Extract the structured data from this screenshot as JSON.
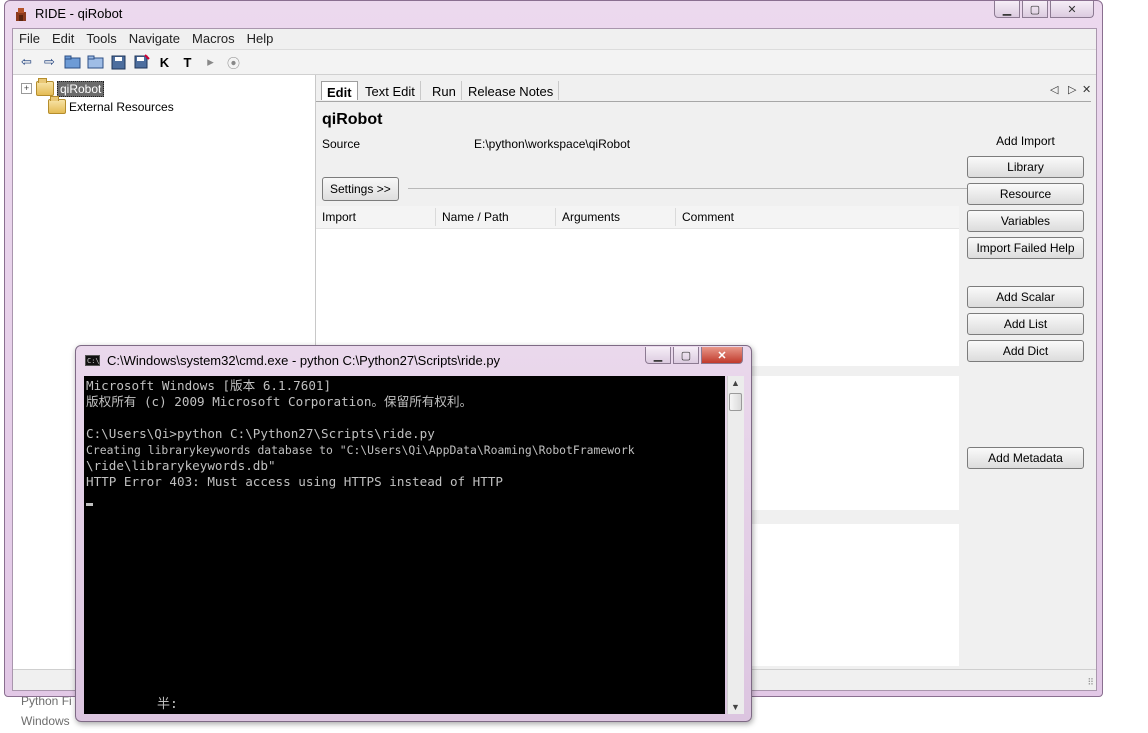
{
  "ride": {
    "title": "RIDE - qiRobot",
    "menu": [
      "File",
      "Edit",
      "Tools",
      "Navigate",
      "Macros",
      "Help"
    ],
    "toolbar_icons": [
      "back-icon",
      "forward-icon",
      "open-suite-icon",
      "open-directory-icon",
      "save-icon",
      "save-all-icon",
      "keyword-search-icon",
      "test-search-icon",
      "run-icon",
      "stop-icon"
    ],
    "toolbar_glyphs": {
      "keyword": "K",
      "test": "T"
    },
    "tree": {
      "root": "qiRobot",
      "external": "External Resources"
    },
    "tabs": [
      "Edit",
      "Text Edit",
      "Run",
      "Release Notes"
    ],
    "editor": {
      "suite_name": "qiRobot",
      "source_label": "Source",
      "source_value": "E:\\python\\workspace\\qiRobot",
      "settings_button": "Settings >>",
      "import_columns": [
        "Import",
        "Name / Path",
        "Arguments",
        "Comment"
      ],
      "add_import_label": "Add Import",
      "import_buttons": [
        "Library",
        "Resource",
        "Variables",
        "Import Failed Help"
      ],
      "variable_buttons": [
        "Add Scalar",
        "Add List",
        "Add Dict"
      ],
      "metadata_button": "Add Metadata"
    }
  },
  "cmd": {
    "title": "C:\\Windows\\system32\\cmd.exe - python  C:\\Python27\\Scripts\\ride.py",
    "lines": [
      "Microsoft Windows [版本 6.1.7601]",
      "版权所有 (c) 2009 Microsoft Corporation。保留所有权利。",
      "",
      "C:\\Users\\Qi>python C:\\Python27\\Scripts\\ride.py",
      "Creating librarykeywords database to \"C:\\Users\\Qi\\AppData\\Roaming\\RobotFramework",
      "\\ride\\librarykeywords.db\"",
      "HTTP Error 403: Must access using HTTPS instead of HTTP"
    ],
    "ime_status": "半:"
  },
  "desktop": {
    "snippets": [
      "Python Fi",
      "Windows"
    ]
  },
  "colors": {
    "window_frame": "#e2c8e6",
    "console_bg": "#000000",
    "console_text": "#c0c0c0",
    "close_button": "#c0392b"
  }
}
